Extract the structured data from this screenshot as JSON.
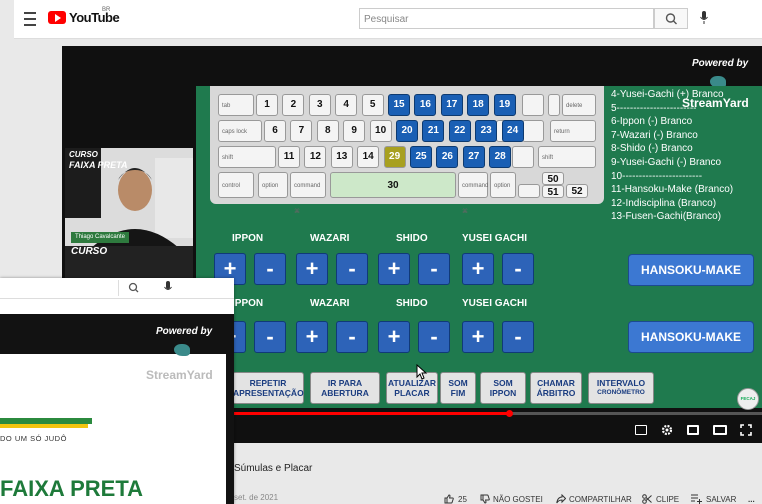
{
  "youtube": {
    "logo": "YouTube",
    "logo_sup": "BR",
    "search_placeholder": "Pesquisar"
  },
  "stream": {
    "powered_by": "Powered by",
    "brand": "StreamYard"
  },
  "webcam": {
    "name_tag": "Thiago Cavalcante",
    "banner_line1": "CURSO",
    "banner_line2": "FAIXA PRETA"
  },
  "keyboard": {
    "row1": [
      "1",
      "2",
      "3",
      "4",
      "5",
      "15",
      "16",
      "17",
      "18",
      "19"
    ],
    "row2": [
      "6",
      "7",
      "8",
      "9",
      "10",
      "20",
      "21",
      "22",
      "23",
      "24"
    ],
    "row3": [
      "11",
      "12",
      "13",
      "14",
      "29",
      "25",
      "26",
      "27",
      "28"
    ],
    "space": "30",
    "nums": [
      "50",
      "51",
      "52"
    ],
    "mods": [
      "tab",
      "caps lock",
      "shift",
      "control",
      "option",
      "command ⌘",
      "command ⌘",
      "option",
      "return",
      "shift",
      "delete"
    ]
  },
  "penalty_list": [
    "4-Yusei-Gachi (+) Branco",
    "5------------------------",
    "6-Ippon (-) Branco",
    "7-Wazari (-) Branco",
    "8-Shido (-) Branco",
    "9-Yusei-Gachi (-) Branco",
    "10------------------------",
    "11-Hansoku-Make (Branco)",
    "12-Indisciplina (Branco)",
    "13-Fusen-Gachi(Branco)"
  ],
  "score_labels": [
    "IPPON",
    "WAZARI",
    "SHIDO",
    "YUSEI GACHI"
  ],
  "score_labels_row2": [
    "IPPON",
    "WAZARI",
    "SHIDO",
    "YUSEI GACHI"
  ],
  "plus": "+",
  "minus": "-",
  "hansoku": "HANSOKU-MAKE",
  "bottom_buttons": [
    [
      "REPETIR",
      "APRESENTAÇÃO"
    ],
    [
      "IR PARA",
      "ABERTURA"
    ],
    [
      "ATUALIZAR",
      "PLACAR"
    ],
    [
      "SOM",
      "FIM"
    ],
    [
      "SOM",
      "IPPON"
    ],
    [
      "CHAMAR",
      "ÁRBITRO"
    ],
    [
      "INTERVALO",
      "CRONÔMETRO"
    ]
  ],
  "fecaj": "FECAJ",
  "popup": {
    "powered_by": "Powered by",
    "brand": "StreamYard",
    "tagline": "DO UM SÓ JUDÔ",
    "title": "FAIXA PRETA"
  },
  "video_title": "Súmulas e Placar",
  "video_date": "set. de 2021",
  "actions": {
    "likes": "25",
    "dislike": "NÃO GOSTEI",
    "share": "COMPARTILHAR",
    "clip": "CLIPE",
    "save": "SALVAR",
    "more": "..."
  },
  "colors": {
    "board_green": "#1f7a4e",
    "button_blue": "#2d63b8",
    "youtube_red": "#ff0000"
  }
}
